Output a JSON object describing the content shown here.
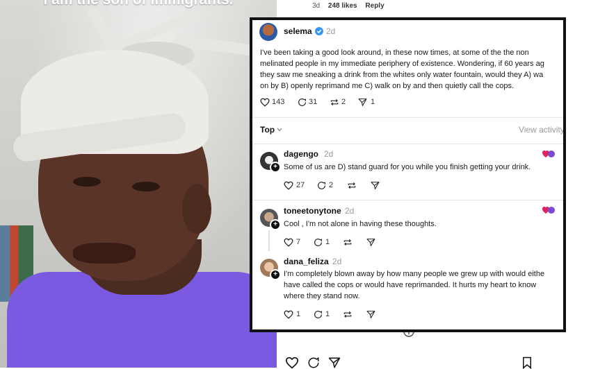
{
  "video": {
    "caption": "I am the son of immigrants."
  },
  "page_meta": {
    "time": "3d",
    "likes": "248 likes",
    "reply": "Reply"
  },
  "post": {
    "username": "selema",
    "time": "2d",
    "lines": [
      "I've been taking a good look around, in these now times, at some of the the non",
      "melinated people in my immediate periphery of existence. Wondering, if 60 years ag",
      "they saw me sneaking a drink from the whites only water fountain, would they A) wa",
      "on by B) openly reprimand me C) walk on by and then quietly call the cops."
    ],
    "likes": "143",
    "comments": "31",
    "reposts": "2",
    "shares": "1"
  },
  "sort": {
    "label": "Top",
    "activity": "View activity"
  },
  "replies": [
    {
      "username": "dagengo",
      "time": "2d",
      "lines": [
        "Some of us are D) stand guard for you while you finish getting your drink."
      ],
      "likes": "27",
      "comments": "2"
    },
    {
      "username": "toneetonytone",
      "time": "2d",
      "lines": [
        "Cool , I'm not alone in having these thoughts."
      ],
      "likes": "7",
      "comments": "1"
    },
    {
      "username": "dana_feliza",
      "time": "2d",
      "lines": [
        "I'm completely blown away by how many people we grew up with would eithe",
        "have called the cops or would have reprimanded. It hurts my heart to know",
        "where they stand now."
      ],
      "likes": "1",
      "comments": "1"
    }
  ],
  "colors": {
    "verified": "#3897f0",
    "shirt": "#7a5ae0",
    "border": "#111111"
  },
  "icons": [
    "heart-icon",
    "comment-icon",
    "repost-icon",
    "share-icon",
    "verified-badge-icon",
    "chevron-down-icon",
    "follow-plus-icon",
    "bookmark-icon"
  ]
}
